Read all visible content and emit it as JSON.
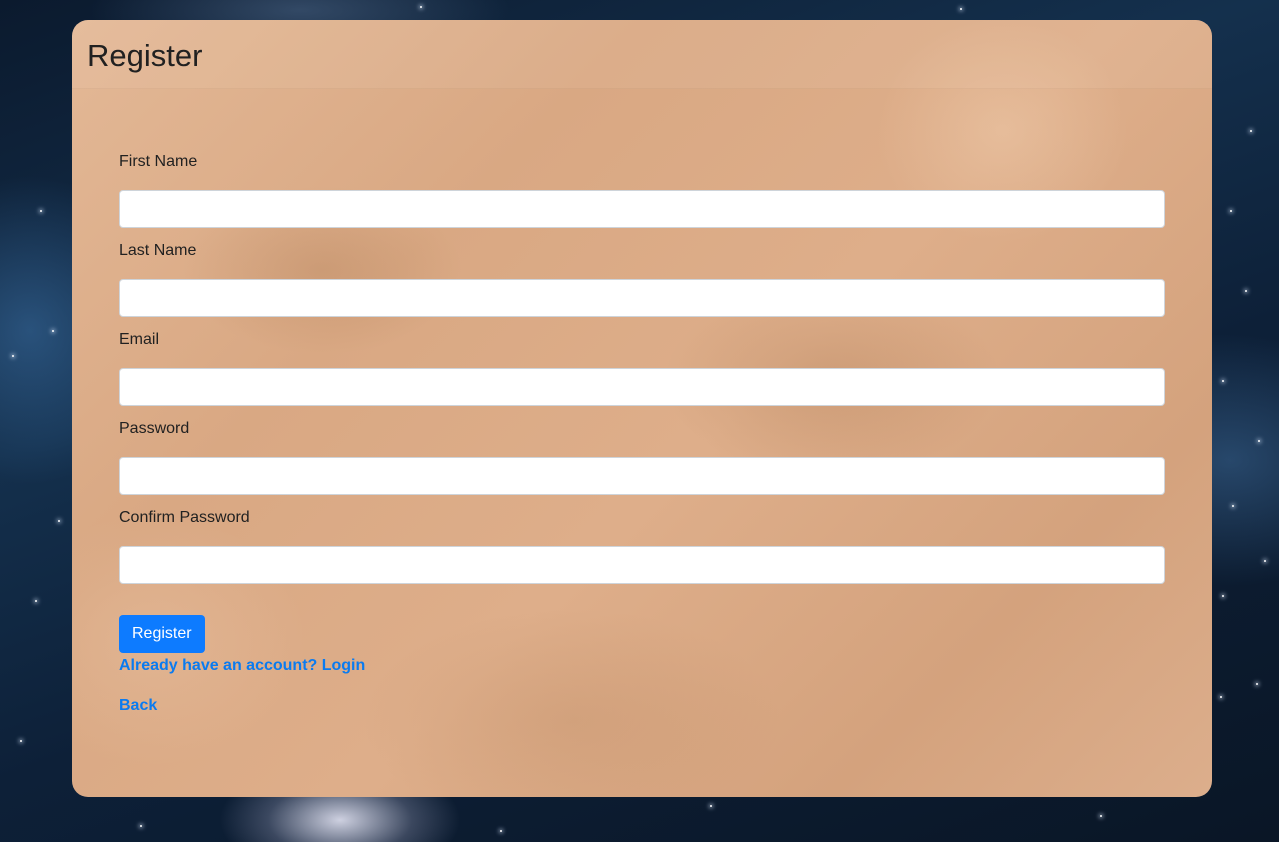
{
  "page": {
    "title": "Register"
  },
  "form": {
    "fields": [
      {
        "label": "First Name",
        "value": "",
        "placeholder": ""
      },
      {
        "label": "Last Name",
        "value": "",
        "placeholder": ""
      },
      {
        "label": "Email",
        "value": "",
        "placeholder": ""
      },
      {
        "label": "Password",
        "value": "",
        "placeholder": ""
      },
      {
        "label": "Confirm Password",
        "value": "",
        "placeholder": ""
      }
    ],
    "submit_label": "Register",
    "login_link": "Already have an account? Login",
    "back_link": "Back"
  },
  "colors": {
    "accent": "#0d7bff",
    "link": "#0a7bf0",
    "card": "#dcae8c",
    "background": "#0d2038"
  }
}
